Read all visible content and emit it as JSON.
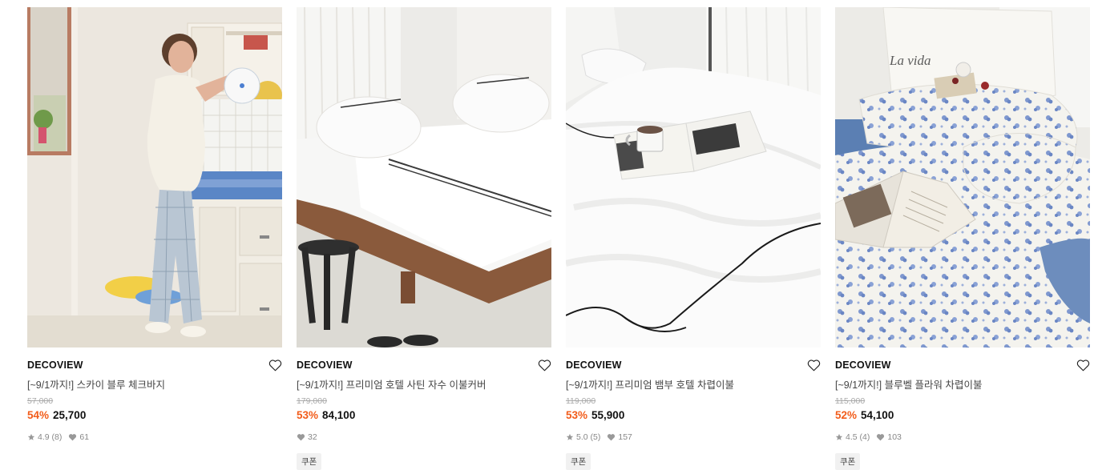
{
  "products": [
    {
      "brand": "DECOVIEW",
      "title": "[~9/1까지!] 스카이 블루 체크바지",
      "original_price": "57,000",
      "discount": "54%",
      "price": "25,700",
      "rating": "4.9",
      "reviews": "(8)",
      "likes": "61",
      "coupon": ""
    },
    {
      "brand": "DECOVIEW",
      "title": "[~9/1까지!] 프리미엄 호텔 사틴 자수 이불커버",
      "original_price": "179,000",
      "discount": "53%",
      "price": "84,100",
      "rating": "",
      "reviews": "",
      "likes": "32",
      "coupon": "쿠폰"
    },
    {
      "brand": "DECOVIEW",
      "title": "[~9/1까지!] 프리미엄 뱀부 호텔 차렵이불",
      "original_price": "119,000",
      "discount": "53%",
      "price": "55,900",
      "rating": "5.0",
      "reviews": "(5)",
      "likes": "157",
      "coupon": "쿠폰"
    },
    {
      "brand": "DECOVIEW",
      "title": "[~9/1까지!] 블루벨 플라워 차렵이불",
      "original_price": "115,000",
      "discount": "52%",
      "price": "54,100",
      "rating": "4.5",
      "reviews": "(4)",
      "likes": "103",
      "coupon": "쿠폰"
    }
  ],
  "pillow_text": "La vida",
  "colors": {
    "discount": "#f25c1a",
    "meta": "#888888",
    "coupon_bg": "#f1f1f1"
  },
  "icons": {
    "wishlist": "heart-outline-icon",
    "rating": "star-icon",
    "likes": "heart-filled-icon"
  }
}
